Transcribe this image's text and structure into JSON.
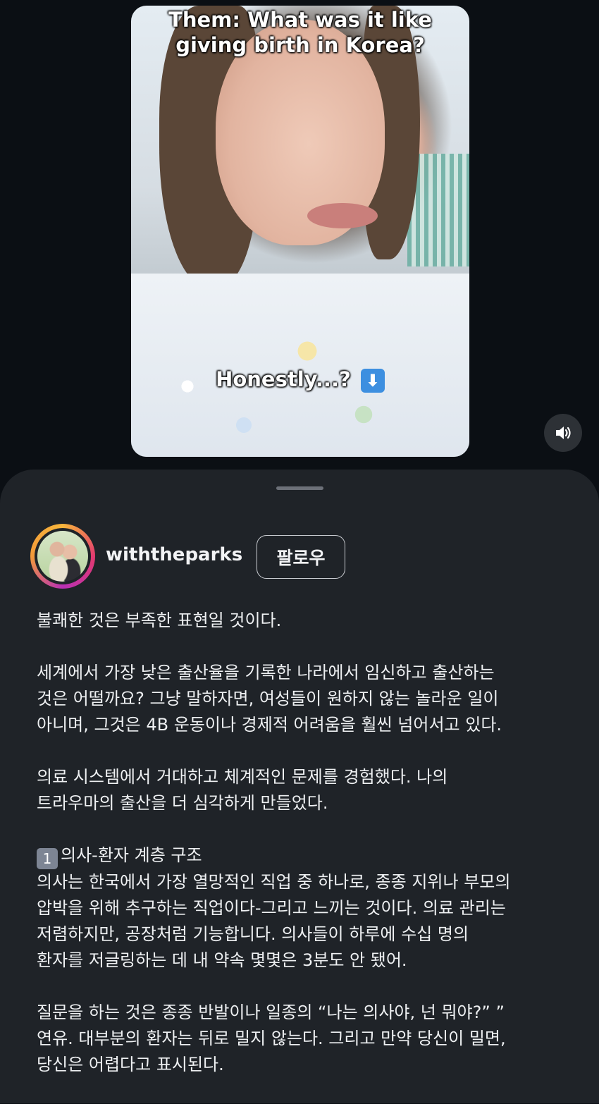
{
  "video": {
    "caption_top_line1": "Them: What was it like",
    "caption_top_line2": "giving birth in Korea?",
    "caption_middle": "Honestly...?",
    "caption_middle_emoji": "⬇",
    "sound_icon": "speaker-icon"
  },
  "profile": {
    "username": "withtheparks",
    "follow_label": "팔로우"
  },
  "post": {
    "p1": [
      "불쾌한 것은 부족한 표현일 것이다."
    ],
    "p2": [
      "세계에서 가장 낮은 출산율을 기록한 나라에서 임신하고 출산하는",
      "것은 어떨까요? 그냥 말하자면, 여성들이 원하지 않는 놀라운 일이",
      "아니며, 그것은 4B 운동이나 경제적 어려움을 훨씬 넘어서고 있다."
    ],
    "p3": [
      "의료 시스템에서 거대하고 체계적인 문제를 경험했다. 나의",
      "트라우마의 출산을 더 심각하게 만들었다."
    ],
    "p4_badge": "1",
    "p4_heading": "의사-환자 계층 구조",
    "p4": [
      "의사는 한국에서 가장 열망적인 직업 중 하나로, 종종 지위나 부모의",
      "압박을 위해 추구하는 직업이다-그리고 느끼는 것이다. 의료 관리는",
      "저렴하지만, 공장처럼 기능합니다. 의사들이 하루에 수십 명의",
      "환자를 저글링하는 데 내 약속 몇몇은 3분도 안 됐어."
    ],
    "p5": [
      "질문을 하는 것은 종종 반발이나 일종의 “나는 의사야, 넌 뭐야?” ”",
      "연유. 대부분의 환자는 뒤로 밀지 않는다. 그리고 만약 당신이 밀면,",
      "당신은 어렵다고 표시된다."
    ]
  },
  "colors": {
    "background": "#0b0f14",
    "sheet": "#1f2328",
    "text": "#eef0f2"
  }
}
